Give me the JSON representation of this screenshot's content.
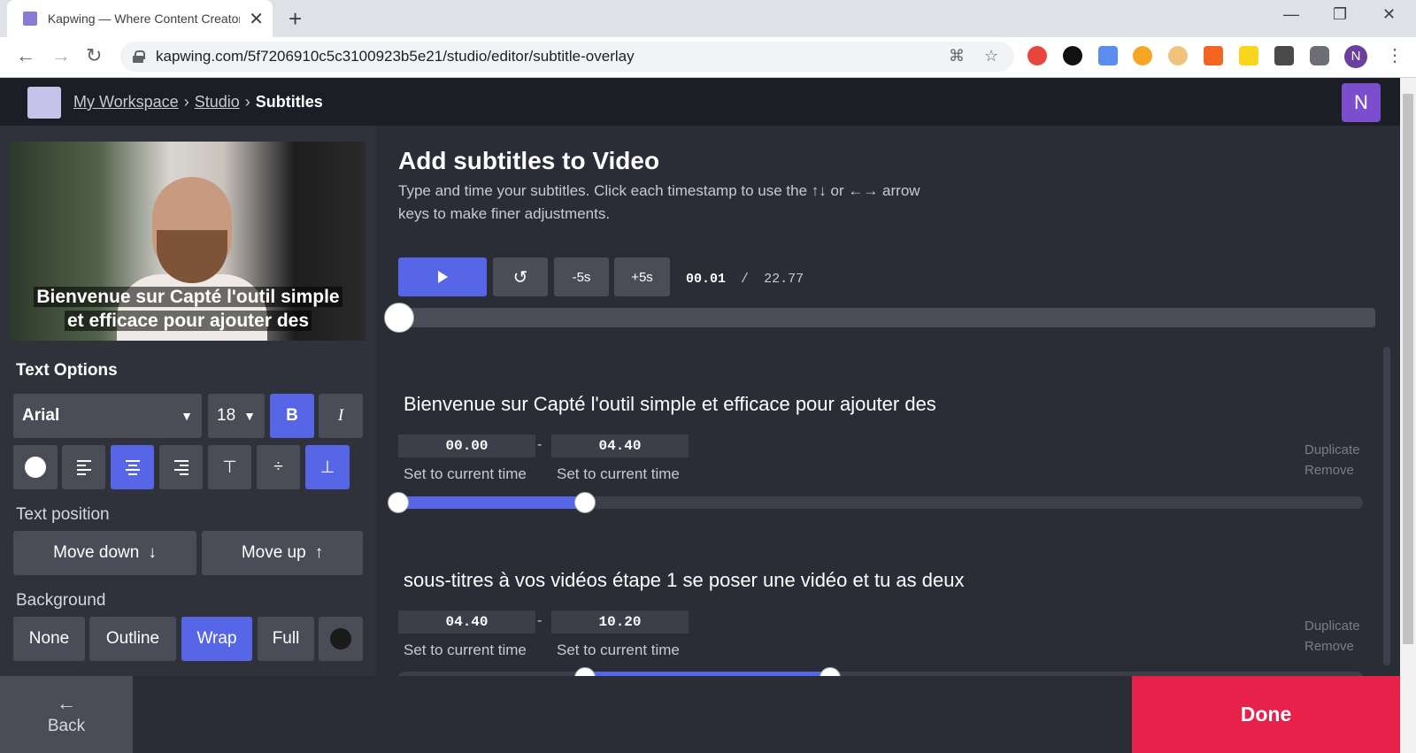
{
  "browser": {
    "tab_title": "Kapwing — Where Content Creators",
    "url": "kapwing.com/5f7206910c5c3100923b5e21/studio/editor/subtitle-overlay",
    "profile_initial": "N"
  },
  "header": {
    "crumbs": [
      "My Workspace",
      "Studio",
      "Subtitles"
    ],
    "user_initial": "N"
  },
  "preview": {
    "subtitle_line1": "Bienvenue sur Capté l'outil simple",
    "subtitle_line2": "et efficace pour ajouter des"
  },
  "text_options": {
    "title": "Text Options",
    "font": "Arial",
    "size": "18",
    "bold_label": "B",
    "italic_label": "I"
  },
  "text_position": {
    "title": "Text position",
    "move_down": "Move down",
    "move_up": "Move up"
  },
  "background": {
    "title": "Background",
    "options": [
      "None",
      "Outline",
      "Wrap",
      "Full"
    ],
    "selected": "Wrap"
  },
  "main": {
    "heading": "Add subtitles to Video",
    "subheading": "Type and time your subtitles. Click each timestamp to use the ↑↓ or ←→ arrow keys to make finer adjustments.",
    "minus5": "-5s",
    "plus5": "+5s",
    "current_time": "00.01",
    "separator": "/",
    "total_time": "22.77",
    "playhead_fraction": 0.0004
  },
  "subtitles": [
    {
      "text": "Bienvenue sur Capté l'outil simple et efficace pour ajouter des",
      "start": "00.00",
      "end": "04.40",
      "set_start": "Set to current time",
      "set_end": "Set to current time",
      "duplicate": "Duplicate",
      "remove": "Remove"
    },
    {
      "text": "sous-titres à vos vidéos étape 1 se poser une vidéo et tu as deux",
      "start": "04.40",
      "end": "10.20",
      "set_start": "Set to current time",
      "set_end": "Set to current time",
      "duplicate": "Duplicate",
      "remove": "Remove"
    }
  ],
  "footer": {
    "back": "Back",
    "done": "Done"
  },
  "colors": {
    "accent": "#5766e6",
    "done": "#e8214a",
    "panel": "#2f313b",
    "header": "#1c1e26"
  }
}
